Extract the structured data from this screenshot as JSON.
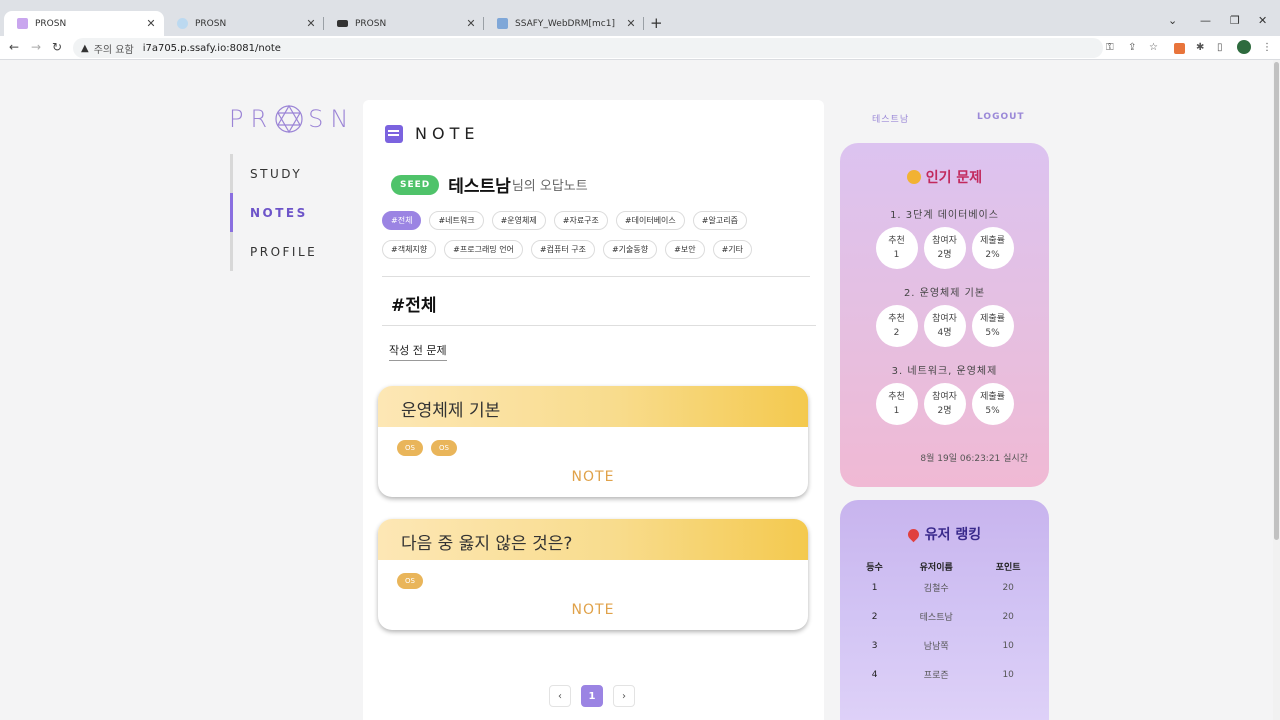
{
  "browser": {
    "tabs": [
      {
        "title": "PROSN",
        "active": true
      },
      {
        "title": "PROSN",
        "active": false
      },
      {
        "title": "PROSN",
        "active": false
      },
      {
        "title": "SSAFY_WebDRM[mc1]",
        "active": false
      }
    ],
    "security_warning": "주의 요함",
    "url": "i7a705.p.ssafy.io:8081/note"
  },
  "logo": {
    "left": "PR",
    "right": "SN"
  },
  "sidebar": {
    "items": [
      {
        "label": "STUDY",
        "active": false
      },
      {
        "label": "NOTES",
        "active": true
      },
      {
        "label": "PROFILE",
        "active": false
      }
    ]
  },
  "main": {
    "heading": "NOTE",
    "badge": "SEED",
    "username": "테스트남",
    "username_suffix": "님의 오답노트",
    "categories": [
      "#전체",
      "#네트워크",
      "#운영체제",
      "#자료구조",
      "#데이터베이스",
      "#알고리즘",
      "#객체지향",
      "#프로그래밍 언어",
      "#컴퓨터 구조",
      "#기술동향",
      "#보안",
      "#기타"
    ],
    "active_category_index": 0,
    "category_title": "#전체",
    "section_title": "작성 전 문제",
    "cards": [
      {
        "title": "운영체제 기본",
        "tags": [
          "OS",
          "OS"
        ],
        "action": "NOTE"
      },
      {
        "title": "다음 중 옳지 않은 것은?",
        "tags": [
          "OS"
        ],
        "action": "NOTE"
      }
    ],
    "pagination": {
      "prev": "‹",
      "current": "1",
      "next": "›"
    }
  },
  "header_links": {
    "user": "테스트남",
    "logout": "LOGOUT"
  },
  "popular": {
    "title": "인기 문제",
    "items": [
      {
        "name": "1. 3단계 데이터베이스",
        "stats": [
          {
            "label": "추천",
            "value": "1"
          },
          {
            "label": "참여자",
            "value": "2명"
          },
          {
            "label": "제출률",
            "value": "2%"
          }
        ]
      },
      {
        "name": "2. 운영체제 기본",
        "stats": [
          {
            "label": "추천",
            "value": "2"
          },
          {
            "label": "참여자",
            "value": "4명"
          },
          {
            "label": "제출률",
            "value": "5%"
          }
        ]
      },
      {
        "name": "3. 네트워크, 운영체제",
        "stats": [
          {
            "label": "추천",
            "value": "1"
          },
          {
            "label": "참여자",
            "value": "2명"
          },
          {
            "label": "제출률",
            "value": "5%"
          }
        ]
      }
    ],
    "footer": "8월 19일 06:23:21 실시간"
  },
  "ranking": {
    "title": "유저 랭킹",
    "headers": [
      "등수",
      "유저이름",
      "포인트"
    ],
    "rows": [
      {
        "rank": "1",
        "name": "김철수",
        "points": "20"
      },
      {
        "rank": "2",
        "name": "테스트남",
        "points": "20"
      },
      {
        "rank": "3",
        "name": "남남쪽",
        "points": "10"
      },
      {
        "rank": "4",
        "name": "프로즌",
        "points": "10"
      }
    ]
  },
  "colors": {
    "accent": "#9b84e3",
    "seed": "#4fc36a",
    "card_note": "#e0a24a"
  }
}
